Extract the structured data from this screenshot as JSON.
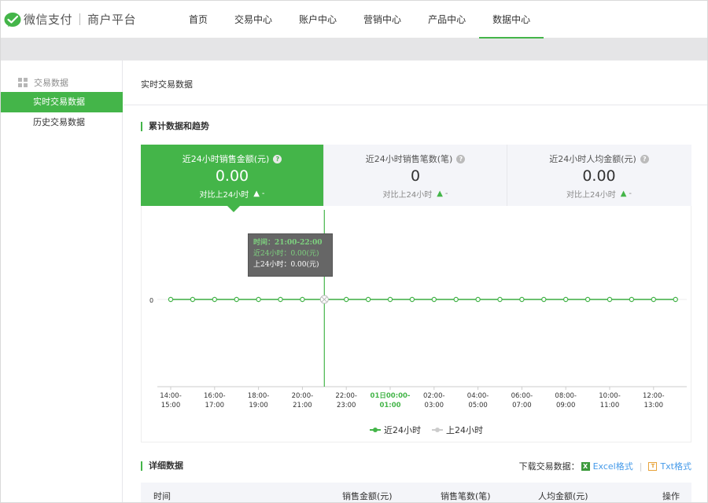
{
  "header": {
    "logo_text": "微信支付",
    "logo_sub": "商户平台",
    "nav": [
      {
        "label": "首页"
      },
      {
        "label": "交易中心"
      },
      {
        "label": "账户中心"
      },
      {
        "label": "营销中心"
      },
      {
        "label": "产品中心"
      },
      {
        "label": "数据中心",
        "active": true
      }
    ],
    "accent_color": "#44b549"
  },
  "sidebar": {
    "group_label": "交易数据",
    "items": [
      {
        "label": "实时交易数据",
        "active": true
      },
      {
        "label": "历史交易数据"
      }
    ]
  },
  "main": {
    "page_title": "实时交易数据",
    "section_title": "累计数据和趋势",
    "cards": [
      {
        "label": "近24小时销售金额(元)",
        "value": "0.00",
        "compare": "对比上24小时",
        "delta": "-",
        "active": true
      },
      {
        "label": "近24小时销售笔数(笔)",
        "value": "0",
        "compare": "对比上24小时",
        "delta": "-"
      },
      {
        "label": "近24小时人均金额(元)",
        "value": "0.00",
        "compare": "对比上24小时",
        "delta": "-"
      }
    ],
    "tooltip": {
      "line1": "时间：21:00-22:00",
      "line2": "近24小时：0.00(元)",
      "line3": "上24小时：0.00(元)"
    },
    "legend": [
      {
        "label": "近24小时",
        "color": "#44b549"
      },
      {
        "label": "上24小时",
        "color": "#cccccc"
      }
    ],
    "detail_title": "详细数据",
    "download": {
      "label": "下载交易数据：",
      "excel": "Excel格式",
      "txt": "Txt格式"
    },
    "table_headers": [
      "时间",
      "销售金额(元)",
      "销售笔数(笔)",
      "人均金额(元)",
      "操作"
    ]
  },
  "chart_data": {
    "type": "line",
    "y_tick_labels": [
      "0"
    ],
    "categories": [
      [
        "14:00-",
        "15:00"
      ],
      [
        "16:00-",
        "17:00"
      ],
      [
        "18:00-",
        "19:00"
      ],
      [
        "20:00-",
        "21:00"
      ],
      [
        "22:00-",
        "23:00"
      ],
      [
        "01日00:00-",
        "01:00"
      ],
      [
        "02:00-",
        "03:00"
      ],
      [
        "04:00-",
        "05:00"
      ],
      [
        "06:00-",
        "07:00"
      ],
      [
        "08:00-",
        "09:00"
      ],
      [
        "10:00-",
        "11:00"
      ],
      [
        "12:00-",
        "13:00"
      ]
    ],
    "highlight_category_index": 5,
    "point_count": 24,
    "hover_index": 7,
    "series": [
      {
        "name": "近24小时",
        "values": [
          0,
          0,
          0,
          0,
          0,
          0,
          0,
          0,
          0,
          0,
          0,
          0,
          0,
          0,
          0,
          0,
          0,
          0,
          0,
          0,
          0,
          0,
          0,
          0
        ],
        "color": "#44b549"
      },
      {
        "name": "上24小时",
        "values": [
          0,
          0,
          0,
          0,
          0,
          0,
          0,
          0,
          0,
          0,
          0,
          0,
          0,
          0,
          0,
          0,
          0,
          0,
          0,
          0,
          0,
          0,
          0,
          0
        ],
        "color": "#cccccc"
      }
    ]
  }
}
